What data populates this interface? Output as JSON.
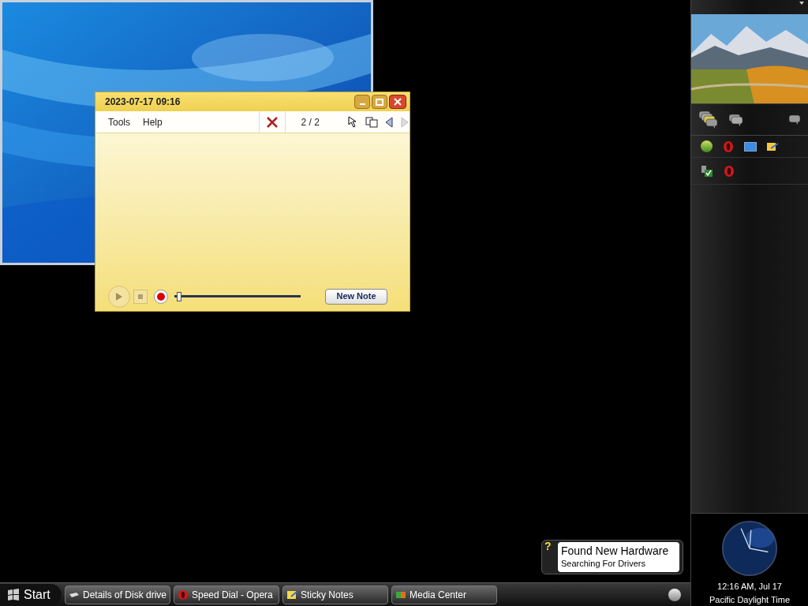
{
  "note_window": {
    "title": "2023-07-17 09:16",
    "menu": [
      "Tools",
      "Help"
    ],
    "counter": "2 / 2",
    "playback": {
      "level": 0.02
    },
    "new_note_button": "New Note"
  },
  "notification": {
    "badge": "?",
    "title": "Found New Hardware",
    "subtitle": "Searching For Drivers"
  },
  "taskbar": {
    "start": "Start",
    "tasks": [
      {
        "label": "Details of Disk drive",
        "kind": "disk"
      },
      {
        "label": "Speed Dial - Opera",
        "kind": "opera"
      },
      {
        "label": "Sticky Notes",
        "kind": "note"
      },
      {
        "label": "Media Center",
        "kind": "media"
      }
    ]
  },
  "sidebar": {
    "clock": {
      "time": "12:16 AM, Jul 17",
      "zone": "Pacific Daylight Time"
    }
  }
}
